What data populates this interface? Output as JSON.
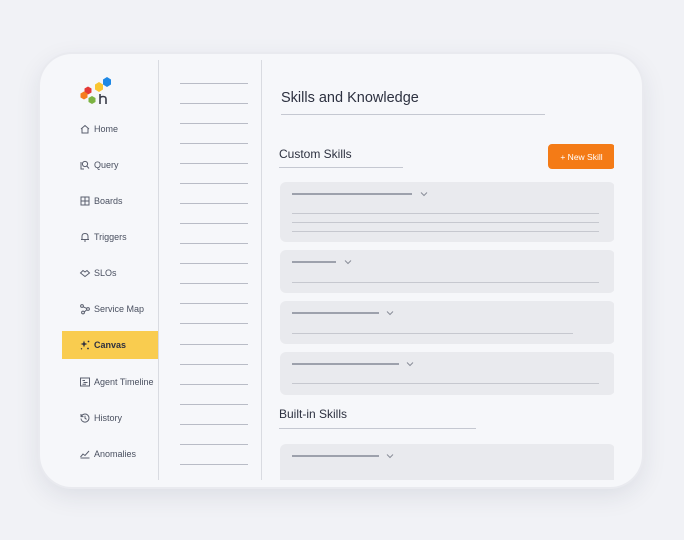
{
  "sidebar": {
    "items": [
      {
        "label": "Home",
        "icon": "home-icon"
      },
      {
        "label": "Query",
        "icon": "query-icon"
      },
      {
        "label": "Boards",
        "icon": "boards-icon"
      },
      {
        "label": "Triggers",
        "icon": "bell-icon"
      },
      {
        "label": "SLOs",
        "icon": "slo-icon"
      },
      {
        "label": "Service Map",
        "icon": "service-map-icon"
      },
      {
        "label": "Canvas",
        "icon": "sparkle-icon",
        "active": true
      },
      {
        "label": "Agent Timeline",
        "icon": "timeline-icon"
      },
      {
        "label": "History",
        "icon": "history-icon"
      },
      {
        "label": "Anomalies",
        "icon": "anomalies-icon"
      }
    ]
  },
  "main": {
    "title": "Skills and Knowledge",
    "custom_section": "Custom Skills",
    "new_skill_label": "+ New Skill",
    "builtin_section": "Built-in Skills"
  },
  "colors": {
    "active_nav": "#f9cc4f",
    "primary_button": "#f47b16",
    "logo_blue": "#1e88e5",
    "logo_yellow": "#f9c531",
    "logo_orange": "#f57c1f",
    "logo_red": "#e53935",
    "logo_green": "#7cb342"
  }
}
